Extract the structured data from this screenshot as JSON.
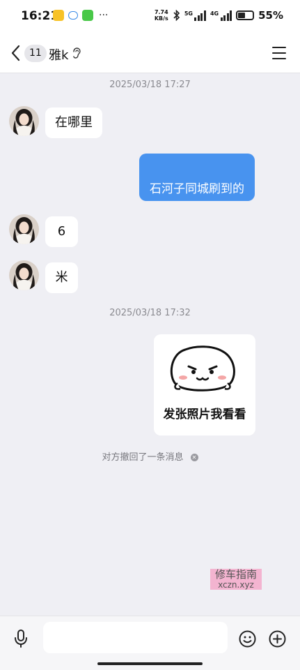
{
  "status_bar": {
    "time": "16:21",
    "more": "···",
    "net_speed_value": "7.74",
    "net_speed_unit": "KB/s",
    "network_1": "5G",
    "network_2": "4G",
    "battery_percent": "55%",
    "battery_level": 0.55
  },
  "header": {
    "unread_count": "11",
    "contact_name": "雅k"
  },
  "messages": {
    "time_1": "2025/03/18 17:27",
    "in_1": "在哪里",
    "out_1": "石河子同城刷到的",
    "in_2": "6",
    "in_3": "米",
    "time_2": "2025/03/18 17:32",
    "sticker_text": "发张照片我看看",
    "recall_notice": "对方撤回了一条消息"
  },
  "watermark": {
    "line1": "修车指南",
    "line2": "xczn.xyz"
  },
  "input": {
    "value": "",
    "placeholder": ""
  },
  "colors": {
    "outgoing_bubble": "#4893ef",
    "chat_background": "#efeff4"
  },
  "icons": [
    "back-icon",
    "ear-icon",
    "menu-icon",
    "mic-icon",
    "emoji-icon",
    "plus-icon"
  ]
}
